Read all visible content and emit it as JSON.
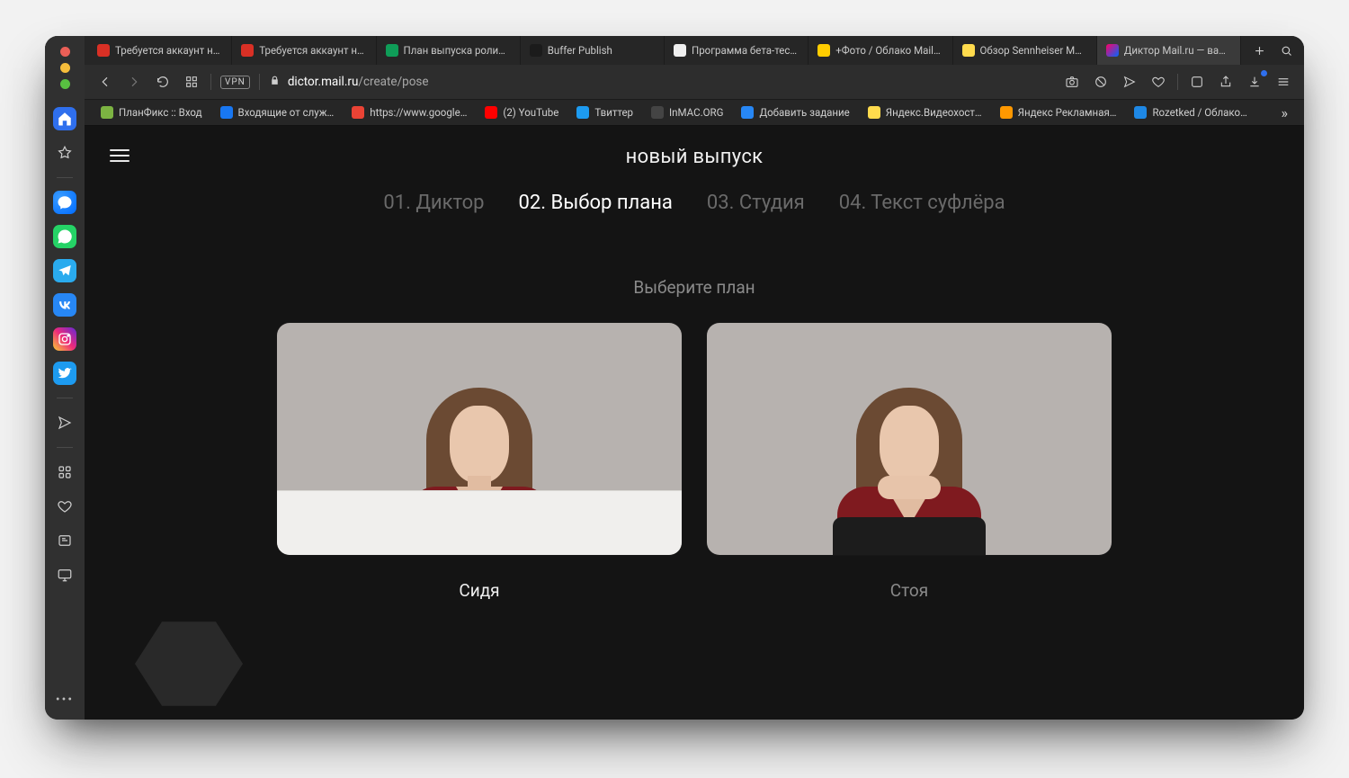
{
  "browser": {
    "tabs": [
      {
        "label": "Требуется аккаунт на Я",
        "favicon": "f-red"
      },
      {
        "label": "Требуется аккаунт на Я",
        "favicon": "f-red"
      },
      {
        "label": "План выпуска роликов н",
        "favicon": "f-green"
      },
      {
        "label": "Buffer Publish",
        "favicon": "f-dark"
      },
      {
        "label": "Программа бета-тестир",
        "favicon": "f-white"
      },
      {
        "label": "+Фото / Облако Mail.ru",
        "favicon": "f-mailru"
      },
      {
        "label": "Обзор Sennheiser Mome",
        "favicon": "f-ya"
      },
      {
        "label": "Диктор Mail.ru — ваш пе",
        "favicon": "f-n",
        "active": true
      }
    ],
    "address": {
      "host": "dictor.mail.ru",
      "path": "/create/pose",
      "vpn": "VPN"
    },
    "bookmarks": [
      {
        "label": "ПланФикс :: Вход",
        "favicon": "f-pf"
      },
      {
        "label": "Входящие от служ…",
        "favicon": "f-blue"
      },
      {
        "label": "https://www.google…",
        "favicon": "f-goo"
      },
      {
        "label": "(2) YouTube",
        "favicon": "f-yt"
      },
      {
        "label": "Твиттер",
        "favicon": "f-tw"
      },
      {
        "label": "InMAC.ORG",
        "favicon": "f-imac"
      },
      {
        "label": "Добавить задание",
        "favicon": "f-vk"
      },
      {
        "label": "Яндекс.Видеохост…",
        "favicon": "f-ya"
      },
      {
        "label": "Яндекс Рекламная…",
        "favicon": "f-orange"
      },
      {
        "label": "Rozetked / Облако…",
        "favicon": "f-rz"
      }
    ]
  },
  "page": {
    "title": "новый выпуск",
    "steps": [
      {
        "label": "01. Диктор",
        "active": false
      },
      {
        "label": "02. Выбор плана",
        "active": true
      },
      {
        "label": "03. Студия",
        "active": false
      },
      {
        "label": "04. Текст суфлёра",
        "active": false
      }
    ],
    "subtitle": "Выберите план",
    "options": [
      {
        "caption": "Сидя",
        "selected": true
      },
      {
        "caption": "Стоя",
        "selected": false
      }
    ]
  }
}
